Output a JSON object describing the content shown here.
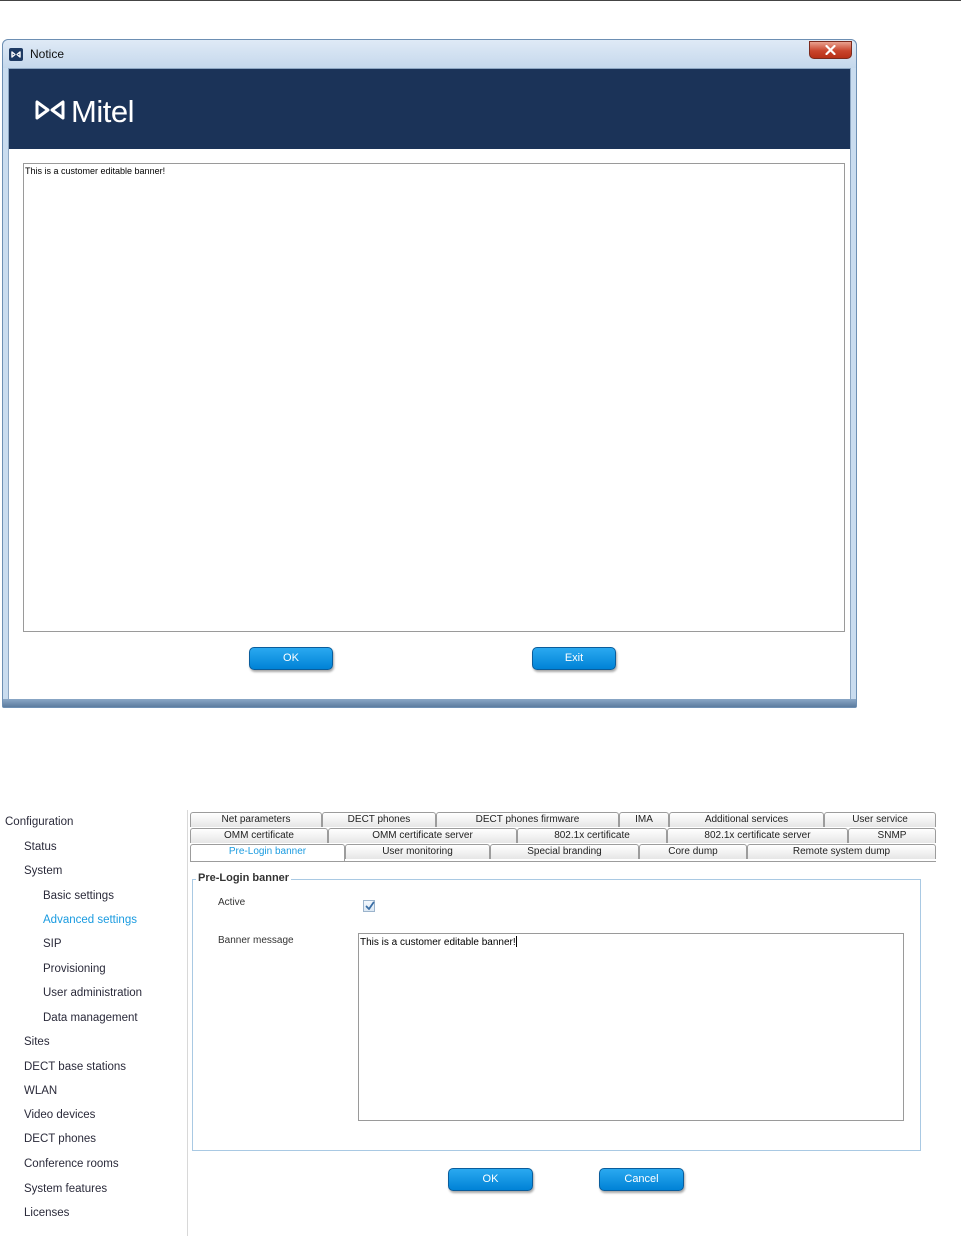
{
  "notice_window": {
    "title": "Notice",
    "logo_text": "Mitel",
    "message": "This is a customer editable banner!",
    "ok_label": "OK",
    "exit_label": "Exit",
    "banner_color": "#1b3358"
  },
  "nav": {
    "items": [
      {
        "label": "Configuration"
      },
      {
        "label": "Status"
      },
      {
        "label": "System"
      },
      {
        "label": "Basic settings"
      },
      {
        "label": "Advanced settings"
      },
      {
        "label": "SIP"
      },
      {
        "label": "Provisioning"
      },
      {
        "label": "User administration"
      },
      {
        "label": "Data management"
      },
      {
        "label": "Sites"
      },
      {
        "label": "DECT base stations"
      },
      {
        "label": "WLAN"
      },
      {
        "label": "Video devices"
      },
      {
        "label": "DECT phones"
      },
      {
        "label": "Conference rooms"
      },
      {
        "label": "System features"
      },
      {
        "label": "Licenses"
      }
    ],
    "active": "Advanced settings"
  },
  "tabs": {
    "row1": [
      "Net parameters",
      "DECT phones",
      "DECT phones firmware",
      "IMA",
      "Additional services",
      "User service"
    ],
    "row2": [
      "OMM certificate",
      "OMM certificate server",
      "802.1x certificate",
      "802.1x certificate server",
      "SNMP"
    ],
    "row3": [
      "Pre-Login banner",
      "User monitoring",
      "Special branding",
      "Core dump",
      "Remote system dump"
    ],
    "active": "Pre-Login banner"
  },
  "form": {
    "legend": "Pre-Login banner",
    "active_label": "Active",
    "active_checked": true,
    "message_label": "Banner message",
    "message_value": "This is a customer editable banner!",
    "ok_label": "OK",
    "cancel_label": "Cancel"
  },
  "colors": {
    "accent": "#1a9be0",
    "button": "#0a8fe0"
  }
}
